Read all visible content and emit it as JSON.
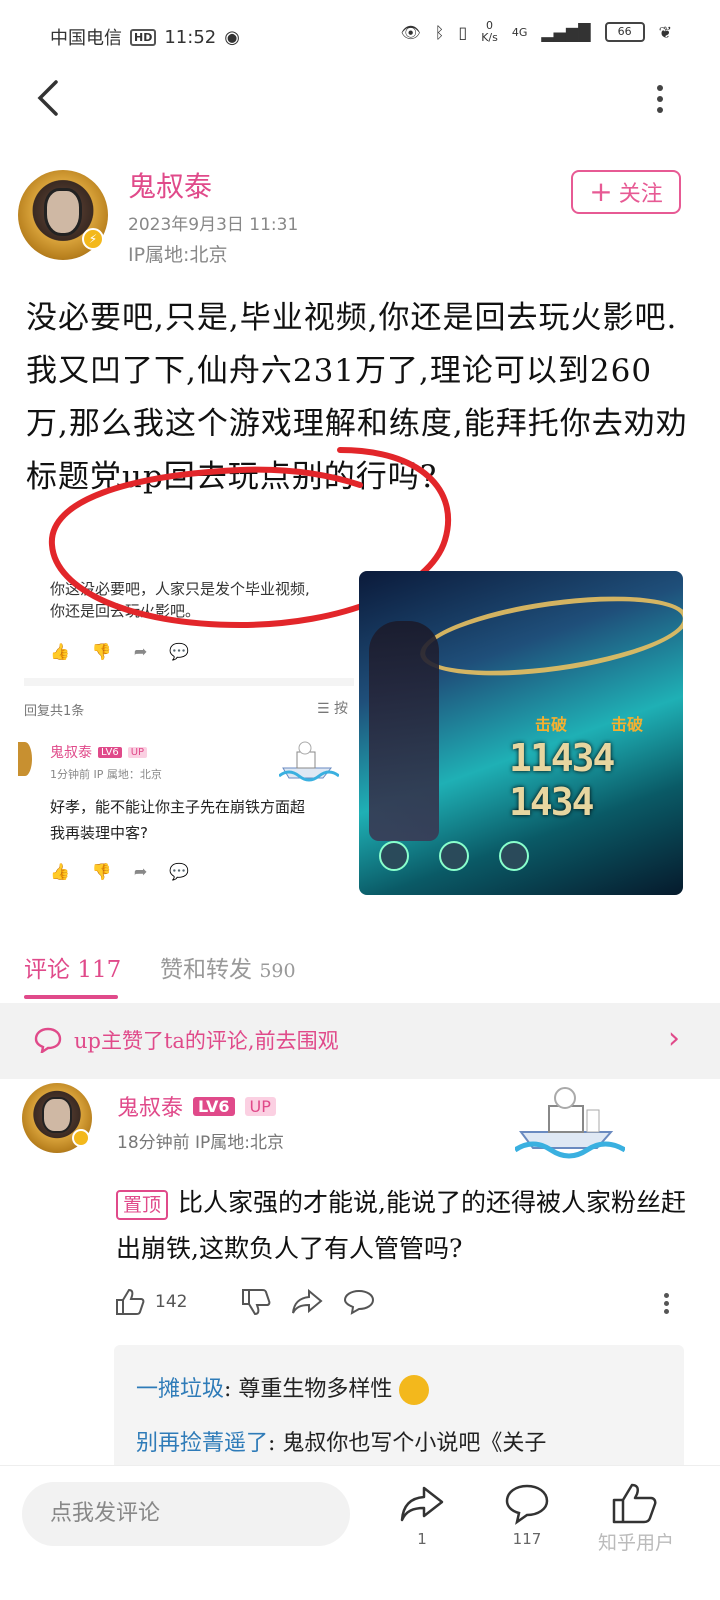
{
  "status_bar": {
    "carrier": "中国电信",
    "hd": "HD",
    "time": "11:52",
    "speed": "0",
    "speed_unit": "K/s",
    "network": "4G",
    "battery": "66"
  },
  "author": {
    "name": "鬼叔泰",
    "date": "2023年9月3日 11:31",
    "ip": "IP属地:北京",
    "follow_label": "关注"
  },
  "post": {
    "lines": [
      "没必要吧,只是,毕业视频,你还是回去玩火影吧.",
      "我又凹了下,仙舟六231万了,理论可以到260万,那么我这个游戏理解和练度,能拜托你去劝劝标题党up回去玩点别的行吗?"
    ]
  },
  "embed": {
    "comment_line1": "你这没必要吧，人家只是发个毕业视频,",
    "comment_line2": "你还是回去玩火影吧。",
    "reply_count": "回复共1条",
    "sort_label": "☰ 按",
    "reply_name": "鬼叔泰",
    "reply_lv": "LV6",
    "reply_up": "UP",
    "reply_meta": "1分钟前  IP 属地：北京",
    "reply_line1": "好孝，能不能让你主子先在崩铁方面超",
    "reply_line2": "我再装理中客?",
    "game_damage": "11434 1434",
    "game_label": "击破"
  },
  "tabs": {
    "comments_label": "评论",
    "comments_count": "117",
    "likes_label": "赞和转发",
    "likes_count": "590"
  },
  "banner": {
    "text": "up主赞了ta的评论,前去围观"
  },
  "comment": {
    "name": "鬼叔泰",
    "level": "LV6",
    "up_tag": "UP",
    "meta": "18分钟前  IP属地:北京",
    "pin_label": "置顶",
    "text": "比人家强的才能说,能说了的还得被人家粉丝赶出崩铁,这欺负人了有人管管吗?",
    "likes": "142",
    "replies": [
      {
        "user": "一摊垃圾",
        "text": ": 尊重生物多样性"
      },
      {
        "user": "别再捡菁遥了",
        "text": ": 鬼叔你也写个小说吧《关子"
      }
    ]
  },
  "bottom": {
    "input_placeholder": "点我发评论",
    "share_count": "1",
    "comment_count": "117",
    "watermark": "知乎用户"
  },
  "colors": {
    "accent": "#e04a8a",
    "reply_user": "#2e7bb8"
  }
}
